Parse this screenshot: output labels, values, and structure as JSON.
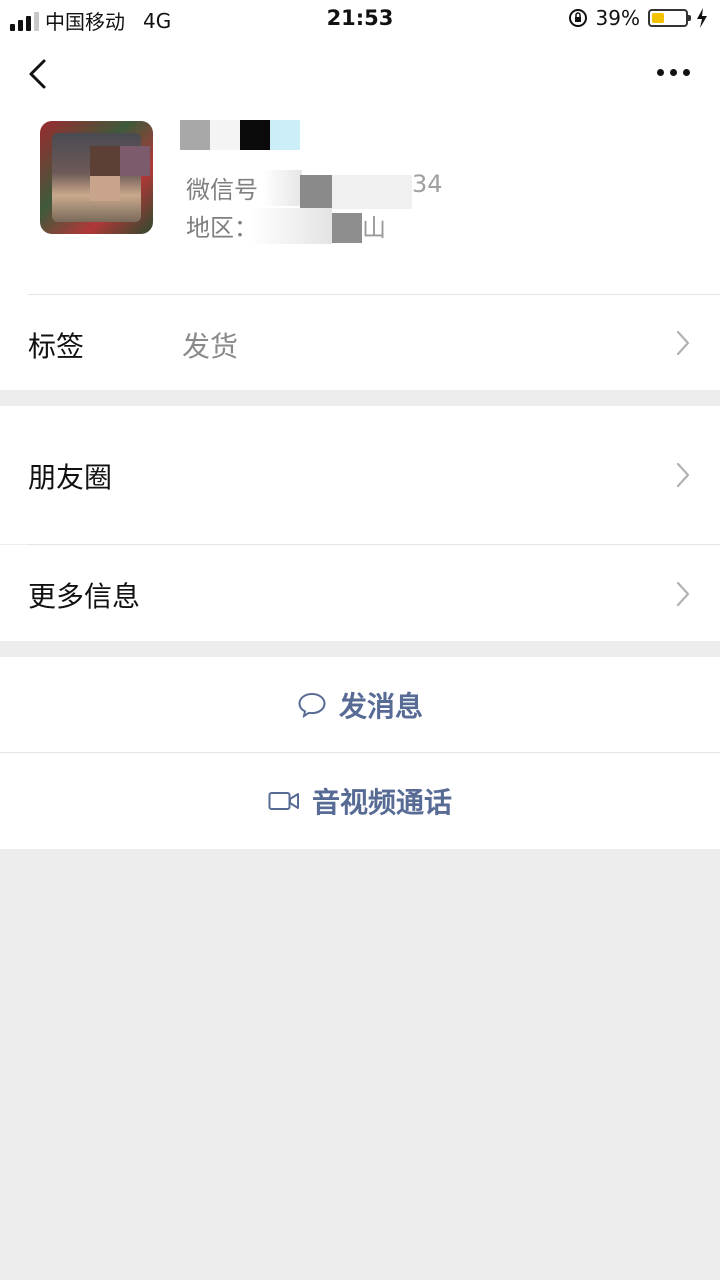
{
  "status_bar": {
    "carrier": "中国移动",
    "network": "4G",
    "time": "21:53",
    "battery_percent": "39%",
    "battery_level": 0.39,
    "battery_color": "#f2c200"
  },
  "nav": {
    "back_icon": "chevron-left-icon",
    "more_icon": "more-dots-icon"
  },
  "profile": {
    "wechat_id_label": "微信号：",
    "wechat_id_visible_suffix": "34",
    "region_label": "地区：",
    "region_visible_suffix": "山"
  },
  "rows": {
    "tags": {
      "label": "标签",
      "value": "发货"
    },
    "moments": {
      "label": "朋友圈"
    },
    "more_info": {
      "label": "更多信息"
    }
  },
  "actions": {
    "send_message": {
      "label": "发消息",
      "icon": "message-bubble-icon"
    },
    "av_call": {
      "label": "音视频通话",
      "icon": "video-camera-icon"
    }
  },
  "colors": {
    "link_blue": "#576b95",
    "background": "#ededed"
  }
}
